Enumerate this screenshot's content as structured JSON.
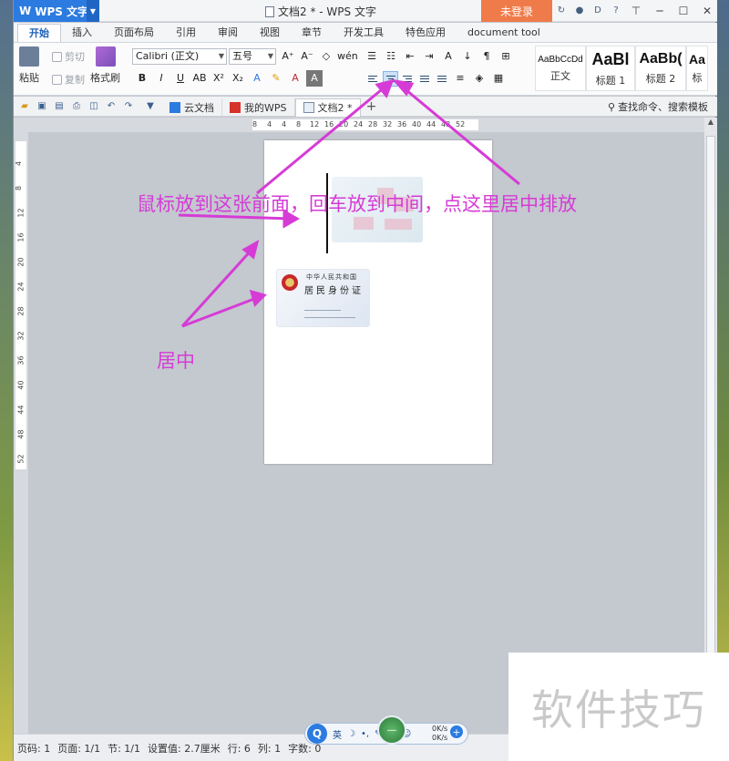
{
  "app": {
    "name": "WPS 文字",
    "window_title": "文档2 * - WPS 文字",
    "login_label": "未登录"
  },
  "tabs": [
    "开始",
    "插入",
    "页面布局",
    "引用",
    "审阅",
    "视图",
    "章节",
    "开发工具",
    "特色应用",
    "document tool"
  ],
  "ribbon": {
    "paste_label": "粘贴",
    "cut_label": "剪切",
    "copy_label": "复制",
    "format_painter_label": "格式刷",
    "font_name": "Calibri (正文)",
    "font_size": "五号",
    "styles": [
      {
        "sample": "AaBbCcDd",
        "name": "正文"
      },
      {
        "sample": "AaBl",
        "name": "标题 1"
      },
      {
        "sample": "AaBb(",
        "name": "标题 2"
      },
      {
        "sample": "Aa",
        "name": "标"
      }
    ]
  },
  "quickbar": {
    "doc_tabs": [
      {
        "label": "云文档",
        "icon": "cloud-doc-icon"
      },
      {
        "label": "我的WPS",
        "icon": "wps-logo-icon"
      },
      {
        "label": "文档2 *",
        "icon": "document-icon",
        "active": true
      }
    ],
    "search_label": "查找命令、搜索模板"
  },
  "ruler": {
    "h_ticks": [
      "8",
      "4",
      "4",
      "8",
      "12",
      "16",
      "20",
      "24",
      "28",
      "32",
      "36",
      "40",
      "44",
      "48",
      "52"
    ],
    "v_ticks": [
      "4",
      "8",
      "12",
      "16",
      "20",
      "24",
      "28",
      "32",
      "36",
      "40",
      "44",
      "48",
      "52"
    ]
  },
  "statusbar": {
    "items": [
      "页码: 1",
      "页面: 1/1",
      "节: 1/1",
      "设置值: 2.7厘米",
      "行: 6",
      "列: 1",
      "字数: 0"
    ]
  },
  "ime": {
    "lang": "英",
    "speed_up": "0K/s",
    "speed_down": "0K/s"
  },
  "annotations": {
    "top": "鼠标放到这张前面，回车放到中间，点这里居中排放",
    "left": "居中"
  },
  "watermark": "软件技巧",
  "colors": {
    "accent": "#2b7be0",
    "annotation": "#d63bd6",
    "login": "#f07b4a"
  }
}
